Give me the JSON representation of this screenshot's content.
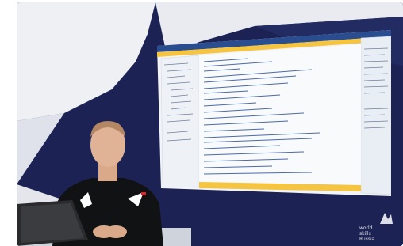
{
  "scene": {
    "description_labels": [],
    "presenter_shirt_text": "",
    "watermark": {
      "line1": "world",
      "line2": "skills",
      "line3": "Russia"
    }
  },
  "colors": {
    "navy": "#1c2354",
    "white_panel": "#f3f4f7",
    "ide_blue": "#2a4d8f",
    "ide_yellow": "#f5c542",
    "code_bg": "#f8fafc",
    "shirt": "#101214"
  },
  "icons": [
    "worldskills-logo-icon"
  ]
}
